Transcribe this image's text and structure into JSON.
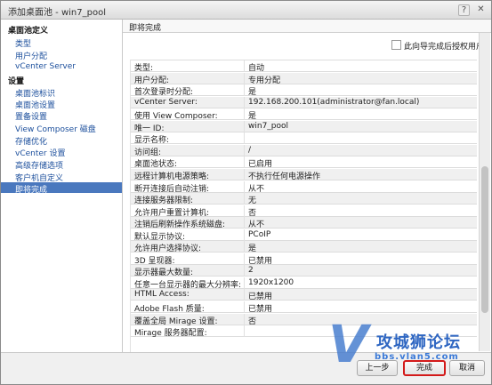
{
  "window": {
    "title": "添加桌面池 - win7_pool",
    "help_icon": "?",
    "close_icon": "✕"
  },
  "sidebar": {
    "groups": [
      {
        "label": "桌面池定义"
      },
      {
        "label": "设置"
      }
    ],
    "items": [
      {
        "label": "类型"
      },
      {
        "label": "用户分配"
      },
      {
        "label": "vCenter Server"
      },
      {
        "label": "桌面池标识"
      },
      {
        "label": "桌面池设置"
      },
      {
        "label": "置备设置"
      },
      {
        "label": "View Composer 磁盘"
      },
      {
        "label": "存储优化"
      },
      {
        "label": "vCenter 设置"
      },
      {
        "label": "高级存储选项"
      },
      {
        "label": "客户机自定义"
      },
      {
        "label": "即将完成"
      }
    ]
  },
  "main": {
    "section_title": "即将完成",
    "entitle_checkbox": {
      "label": "此向导完成后授权用户",
      "checked": false
    },
    "summary_rows": [
      {
        "key": "类型:",
        "value": "自动"
      },
      {
        "key": "用户分配:",
        "value": "专用分配"
      },
      {
        "key": "首次登录时分配:",
        "value": "是"
      },
      {
        "key": "vCenter Server:",
        "value": "192.168.200.101(administrator@fan.local)"
      },
      {
        "key": "使用 View Composer:",
        "value": "是"
      },
      {
        "key": "唯一 ID:",
        "value": "win7_pool"
      },
      {
        "key": "显示名称:",
        "value": ""
      },
      {
        "key": "访问组:",
        "value": "/"
      },
      {
        "key": "桌面池状态:",
        "value": "已启用"
      },
      {
        "key": "远程计算机电源策略:",
        "value": "不执行任何电源操作"
      },
      {
        "key": "断开连接后自动注销:",
        "value": "从不"
      },
      {
        "key": "连接服务器限制:",
        "value": "无"
      },
      {
        "key": "允许用户重置计算机:",
        "value": "否"
      },
      {
        "key": "注销后刷新操作系统磁盘:",
        "value": "从不"
      },
      {
        "key": "默认显示协议:",
        "value": "PCoIP"
      },
      {
        "key": "允许用户选择协议:",
        "value": "是"
      },
      {
        "key": "3D 呈现器:",
        "value": "已禁用"
      },
      {
        "key": "显示器最大数量:",
        "value": "2"
      },
      {
        "key": "任意一台显示器的最大分辨率:",
        "value": "1920x1200"
      },
      {
        "key": "HTML Access:",
        "value": "已禁用"
      },
      {
        "key": "Adobe Flash 质量:",
        "value": "已禁用"
      },
      {
        "key": "覆盖全局 Mirage 设置:",
        "value": "否"
      },
      {
        "key": "Mirage 服务器配置:",
        "value": ""
      }
    ]
  },
  "footer": {
    "back_label": "上一步",
    "finish_label": "完成",
    "cancel_label": "取消"
  },
  "watermark": {
    "logo_letter": "V",
    "brand": "攻城狮论坛",
    "url": "bbs.vlan5.com"
  },
  "colors": {
    "sidebar_selected": "#4a78be",
    "link": "#1c4f9c",
    "finish_highlight": "#d31a1a"
  }
}
